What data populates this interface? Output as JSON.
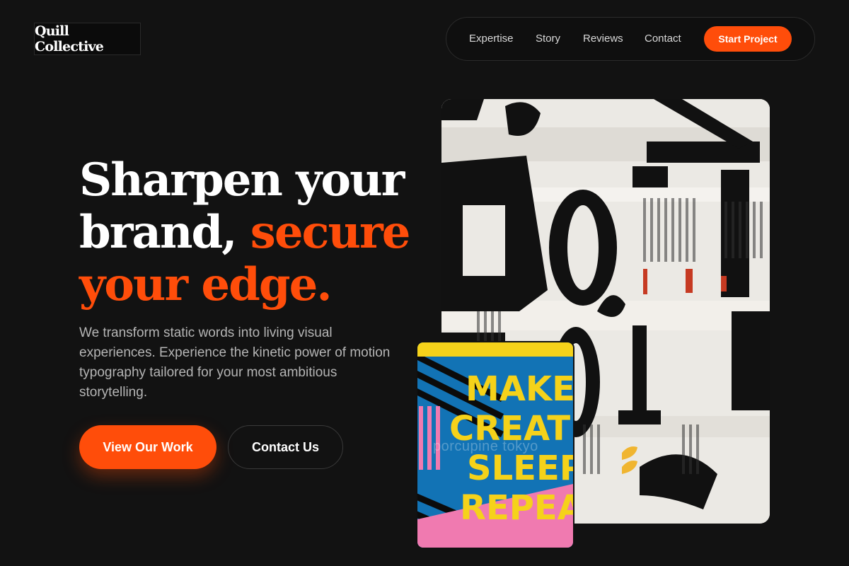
{
  "brand": {
    "name": "Quill Collective"
  },
  "nav": {
    "links": [
      "Expertise",
      "Story",
      "Reviews",
      "Contact"
    ],
    "cta": "Start Project"
  },
  "hero": {
    "headline_white": "Sharpen your brand,",
    "headline_accent": "secure your edge.",
    "description": "We transform static words into living visual experiences. Experience the kinetic power of motion typography tailored for your most ambitious storytelling.",
    "primary_button": "View Our Work",
    "secondary_button": "Contact Us"
  },
  "collage": {
    "poster_words": [
      "MAKE",
      "CREATE",
      "SLEEP",
      "REPEAT"
    ],
    "watermark": "porcupine tokyo",
    "main_image_icon": "newspaper-typography-collage",
    "small_image_icon": "make-create-sleep-repeat-poster"
  },
  "colors": {
    "background": "#121212",
    "accent": "#ff4d0a",
    "poster_yellow": "#f5d21a",
    "poster_blue": "#1273b5",
    "poster_pink": "#f07ab0"
  }
}
